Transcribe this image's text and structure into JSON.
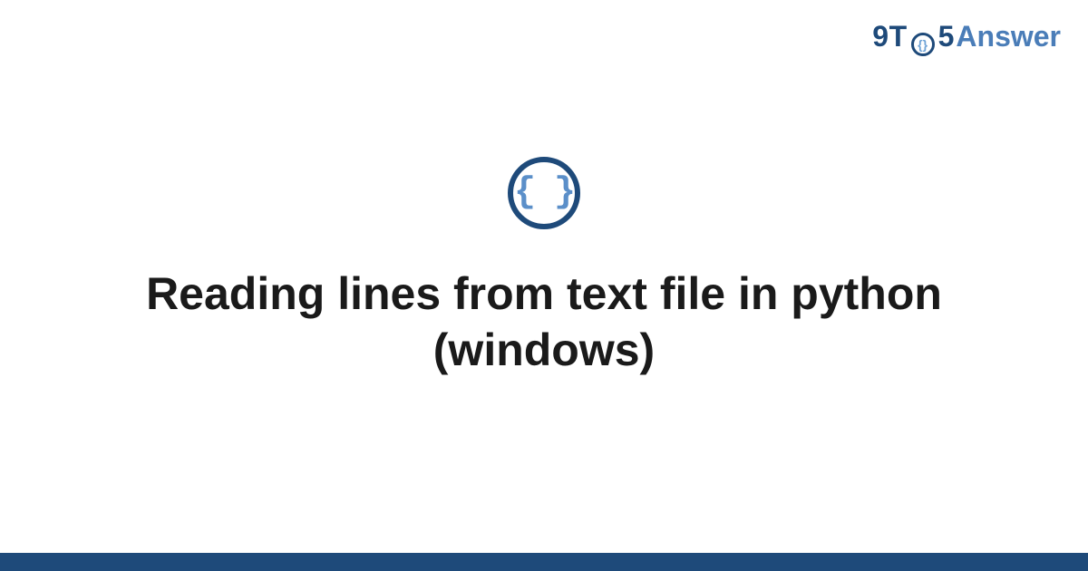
{
  "logo": {
    "part1": "9T",
    "inner": "{}",
    "part2": "5",
    "part3": "Answer"
  },
  "icon": {
    "symbol": "{ }"
  },
  "title": "Reading lines from text file in python (windows)",
  "colors": {
    "primary": "#1e4a7a",
    "secondary": "#4a7db8",
    "accent": "#5b8fc9"
  }
}
